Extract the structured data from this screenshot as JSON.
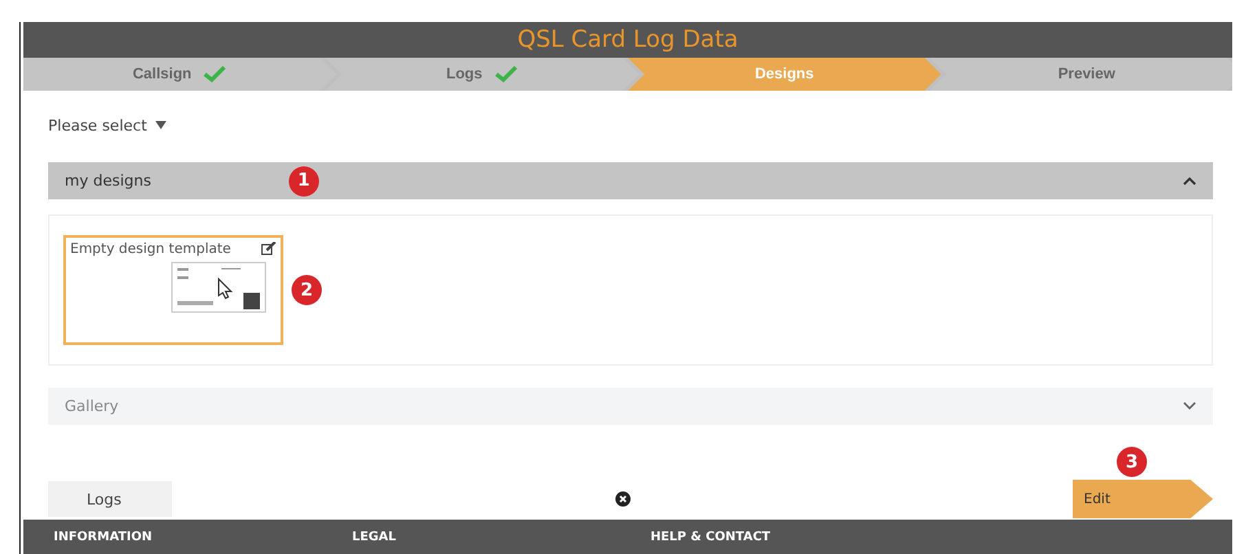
{
  "header": {
    "title": "QSL Card Log Data"
  },
  "steps": [
    {
      "label": "Callsign",
      "completed": true,
      "selected": false
    },
    {
      "label": "Logs",
      "completed": true,
      "selected": false
    },
    {
      "label": "Designs",
      "completed": false,
      "selected": true
    },
    {
      "label": "Preview",
      "completed": false,
      "selected": false
    }
  ],
  "select": {
    "label": "Please select"
  },
  "sections": [
    {
      "title": "my designs",
      "expanded": true,
      "badge": "1",
      "cards": [
        {
          "title": "Empty design template",
          "selected": true,
          "badge": "2"
        }
      ]
    },
    {
      "title": "Gallery",
      "expanded": false
    }
  ],
  "nav": {
    "back": "Logs",
    "next": "Edit",
    "next_badge": "3"
  },
  "footer": [
    "INFORMATION",
    "LEGAL",
    "HELP & CONTACT"
  ]
}
